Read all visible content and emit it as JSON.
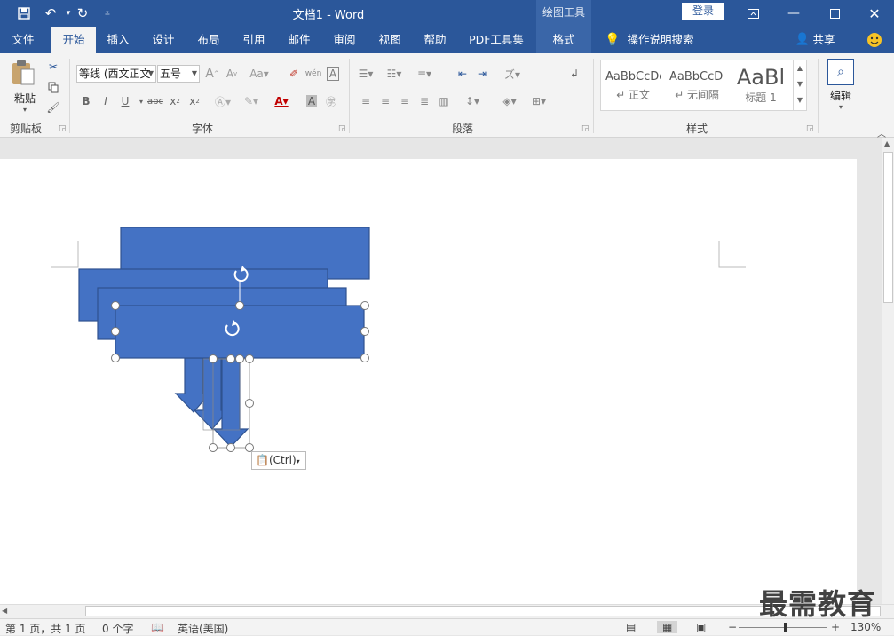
{
  "titlebar": {
    "doc_title": "文档1  -  Word",
    "tools_label": "绘图工具",
    "login": "登录"
  },
  "tabs": [
    {
      "label": "文件"
    },
    {
      "label": "开始"
    },
    {
      "label": "插入"
    },
    {
      "label": "设计"
    },
    {
      "label": "布局"
    },
    {
      "label": "引用"
    },
    {
      "label": "邮件"
    },
    {
      "label": "审阅"
    },
    {
      "label": "视图"
    },
    {
      "label": "帮助"
    },
    {
      "label": "PDF工具集"
    },
    {
      "label": "格式"
    }
  ],
  "tell_me": "操作说明搜索",
  "share": "共享",
  "ribbon": {
    "clipboard": {
      "paste": "粘贴",
      "label": "剪贴板"
    },
    "font": {
      "font_name": "等线 (西文正文",
      "font_size": "五号",
      "label": "字体"
    },
    "paragraph": {
      "label": "段落"
    },
    "styles": {
      "label": "样式",
      "items": [
        {
          "sample": "AaBbCcDd",
          "name": "↵ 正文"
        },
        {
          "sample": "AaBbCcDd",
          "name": "↵ 无间隔"
        },
        {
          "sample": "AaBl",
          "name": "标题 1"
        }
      ]
    },
    "editing": {
      "label": "编辑"
    }
  },
  "canvas": {
    "paste_tag": "(Ctrl)"
  },
  "status": {
    "page": "第 1 页，共 1 页",
    "words": "0 个字",
    "language": "英语(美国)",
    "zoom": "130%"
  },
  "watermark": "最需教育",
  "colors": {
    "brand": "#2b579a",
    "shape_fill": "#4472c4",
    "shape_border": "#2f528f"
  }
}
